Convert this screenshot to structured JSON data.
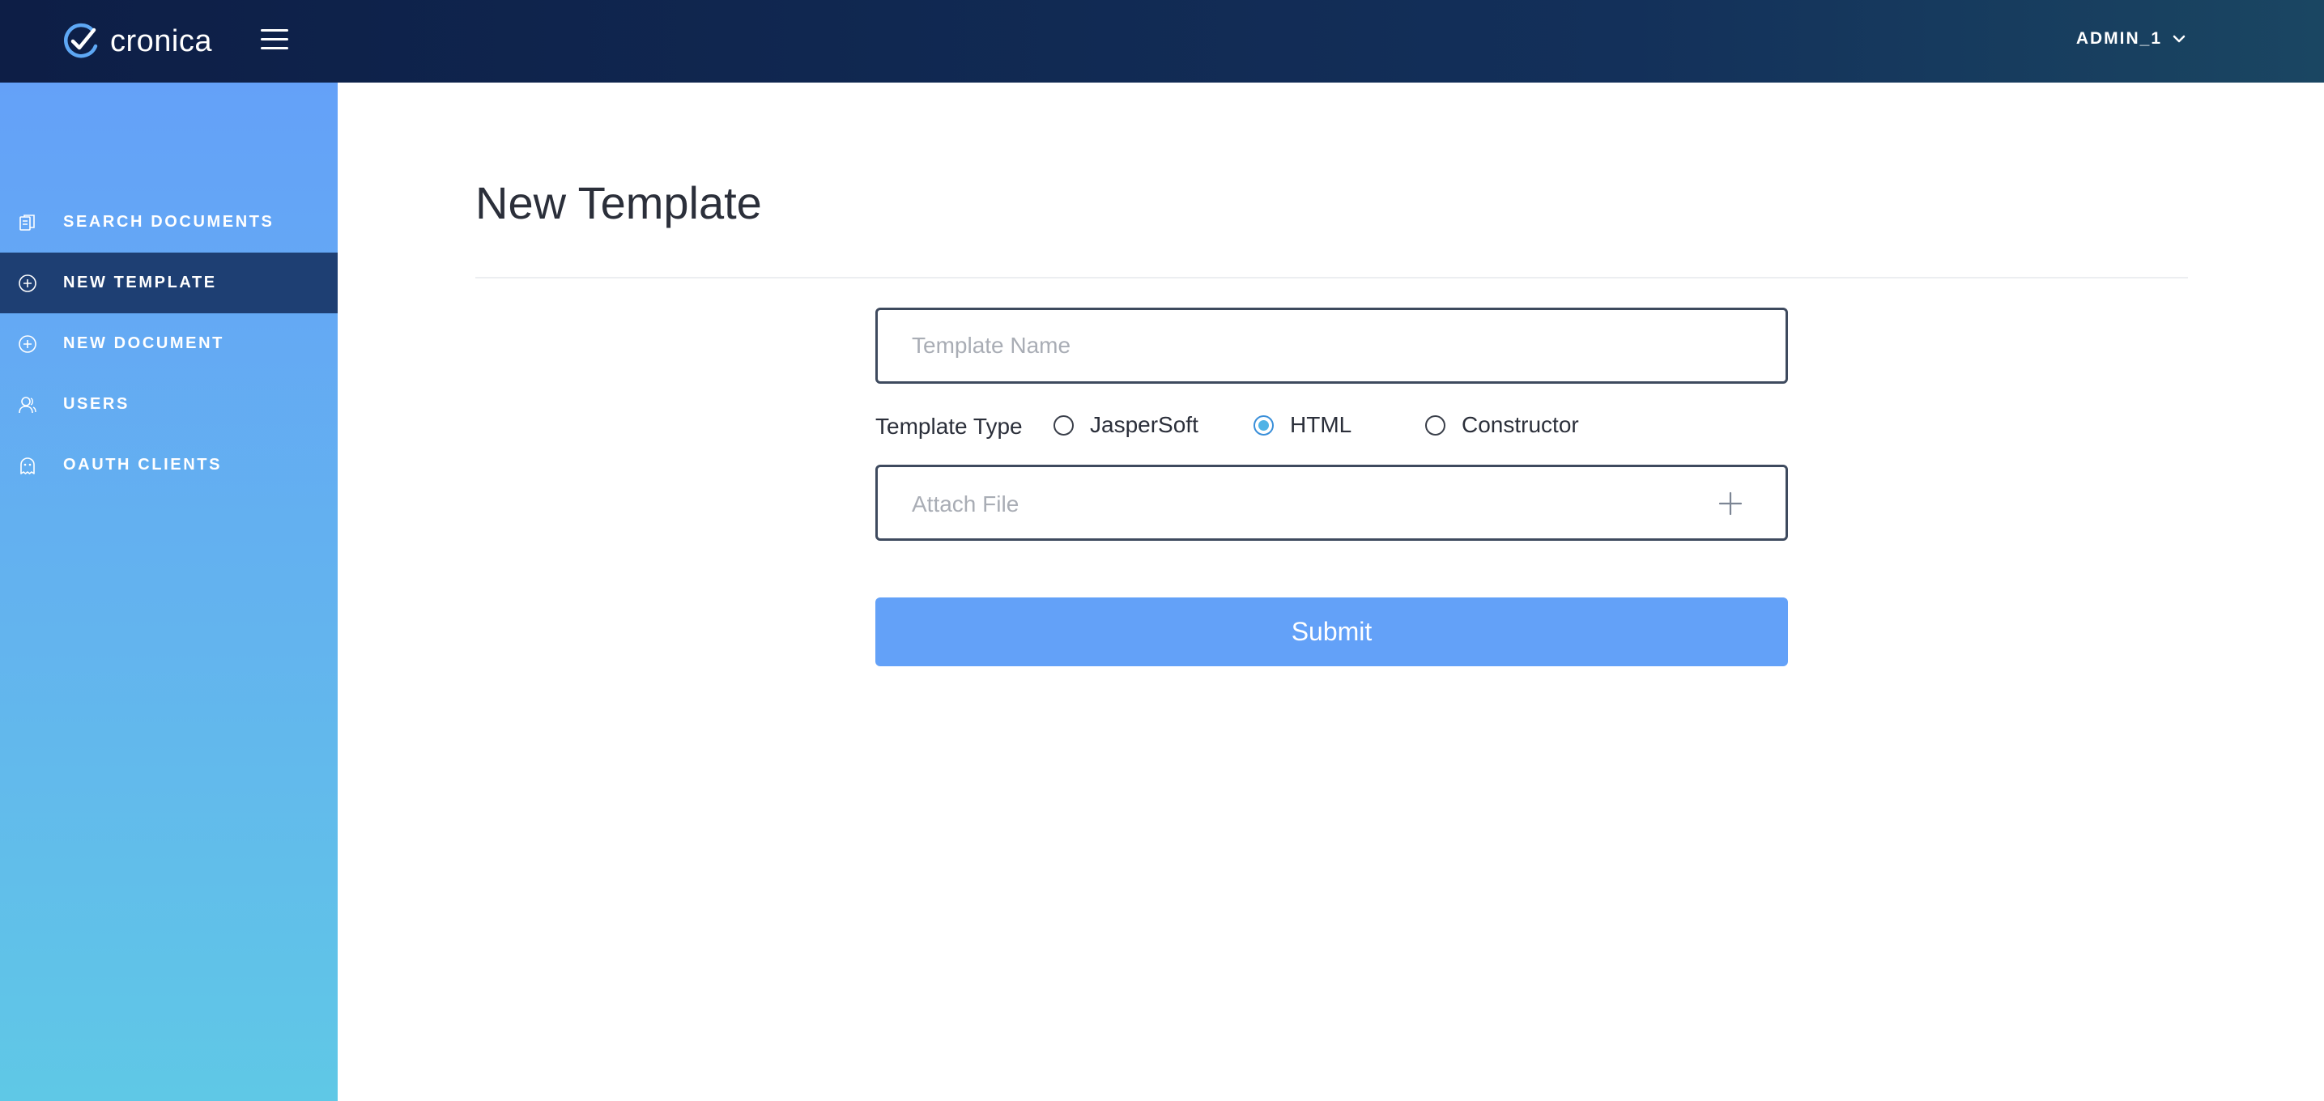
{
  "header": {
    "brand_name": "cronica",
    "logo_icon": "check-circle-icon",
    "menu_icon": "hamburger-icon",
    "user_name": "ADMIN_1"
  },
  "sidebar": {
    "items": [
      {
        "label": "SEARCH DOCUMENTS",
        "icon": "documents-icon",
        "active": false
      },
      {
        "label": "NEW TEMPLATE",
        "icon": "plus-circle-icon",
        "active": true
      },
      {
        "label": "NEW DOCUMENT",
        "icon": "plus-circle-icon",
        "active": false
      },
      {
        "label": "USERS",
        "icon": "users-icon",
        "active": false
      },
      {
        "label": "OAUTH CLIENTS",
        "icon": "ghost-icon",
        "active": false
      }
    ]
  },
  "main": {
    "title": "New Template",
    "template_name_placeholder": "Template Name",
    "template_name_value": "",
    "template_type_label": "Template Type",
    "template_type_options": [
      "JasperSoft",
      "HTML",
      "Constructor"
    ],
    "template_type_selected": "HTML",
    "attach_file_placeholder": "Attach File",
    "submit_label": "Submit"
  },
  "colors": {
    "topbar": "#0d1e46",
    "sidebar_top": "#64a1f8",
    "sidebar_bottom": "#5fc8e6",
    "sidebar_active": "#1e3f73",
    "accent": "#63a1f8",
    "radio_selected": "#4fb3e6"
  }
}
